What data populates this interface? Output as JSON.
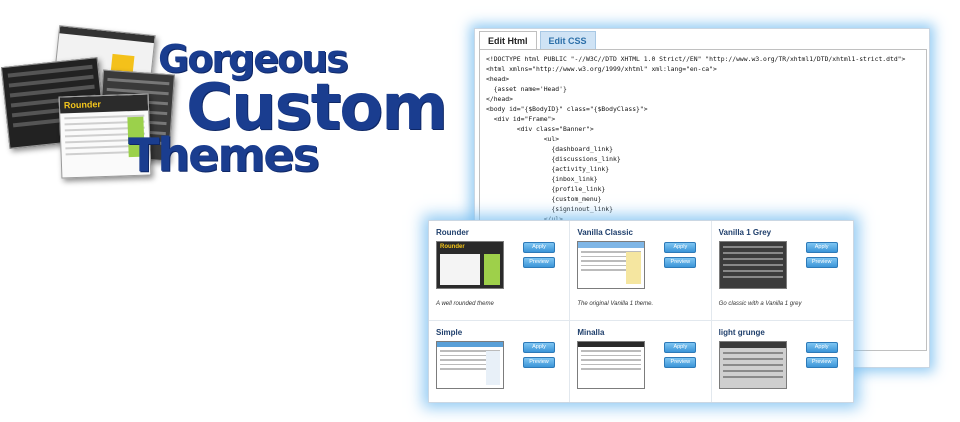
{
  "headline": {
    "line1": "Gorgeous",
    "line2": "Custom",
    "line3": "Themes"
  },
  "collage": {
    "front_shot_title": "Rounder"
  },
  "editor": {
    "tabs": [
      {
        "label": "Edit Html"
      },
      {
        "label": "Edit CSS"
      }
    ],
    "code": "<!DOCTYPE html PUBLIC \"-//W3C//DTD XHTML 1.0 Strict//EN\" \"http://www.w3.org/TR/xhtml1/DTD/xhtml1-strict.dtd\">\n<html xmlns=\"http://www.w3.org/1999/xhtml\" xml:lang=\"en-ca\">\n<head>\n  {asset name='Head'}\n</head>\n<body id=\"{$BodyID}\" class=\"{$BodyClass}\">\n  <div id=\"Frame\">\n        <div class=\"Banner\">\n               <ul>\n                 {dashboard_link}\n                 {discussions_link}\n                 {activity_link}\n                 {inbox_link}\n                 {profile_link}\n                 {custom_menu}\n                 {signinout_link}\n               </ul>\n        </div>\n        <div id=\"Body\">\n               <div class=\"Wrapper\">"
  },
  "buttons": {
    "apply": "Apply",
    "preview": "Preview"
  },
  "themes": [
    {
      "name": "Rounder",
      "description": "A well rounded theme",
      "thumb_title": "Rounder"
    },
    {
      "name": "Vanilla Classic",
      "description": "The original Vanilla 1 theme."
    },
    {
      "name": "Vanilla 1 Grey",
      "description": "Go classic with a Vanilla 1 grey"
    },
    {
      "name": "Simple",
      "description": ""
    },
    {
      "name": "Minalla",
      "description": ""
    },
    {
      "name": "light grunge",
      "description": ""
    }
  ]
}
